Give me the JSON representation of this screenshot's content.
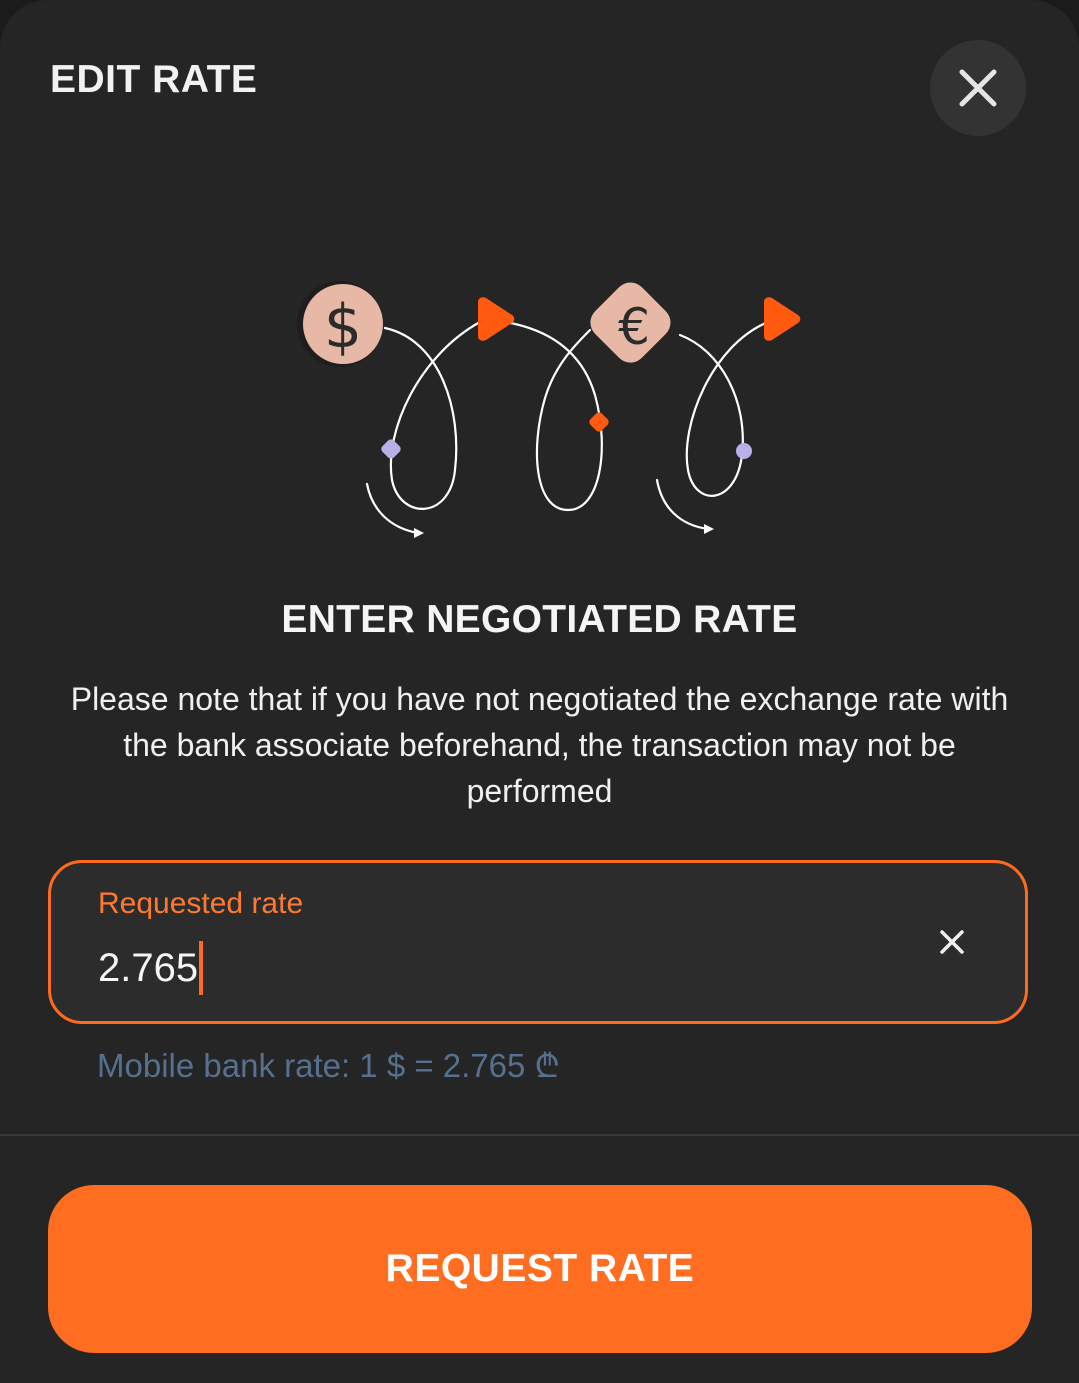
{
  "header": {
    "title": "EDIT RATE",
    "close_icon": "close-icon"
  },
  "illustration": {
    "icons": [
      "dollar-coin-icon",
      "euro-coin-icon",
      "arrow-right-icon"
    ],
    "colors": {
      "coin": "#e8b8a6",
      "arrow": "#ff5a10",
      "dot_purple": "#b9b0e8",
      "dot_orange": "#ff5a10",
      "line": "#ffffff"
    }
  },
  "main": {
    "heading": "ENTER NEGOTIATED RATE",
    "note": "Please note that if you have not negotiated the exchange rate with the bank associate beforehand, the transaction may not be performed"
  },
  "rate_field": {
    "label": "Requested rate",
    "value": "2.765",
    "clear_icon": "clear-icon"
  },
  "hint": {
    "text": "Mobile bank rate: 1 $ = 2.765 ₾"
  },
  "footer": {
    "button_label": "REQUEST RATE"
  },
  "colors": {
    "accent": "#ff6d20",
    "background": "#252525",
    "field_background": "#2c2c2c",
    "hint": "#56708f"
  }
}
